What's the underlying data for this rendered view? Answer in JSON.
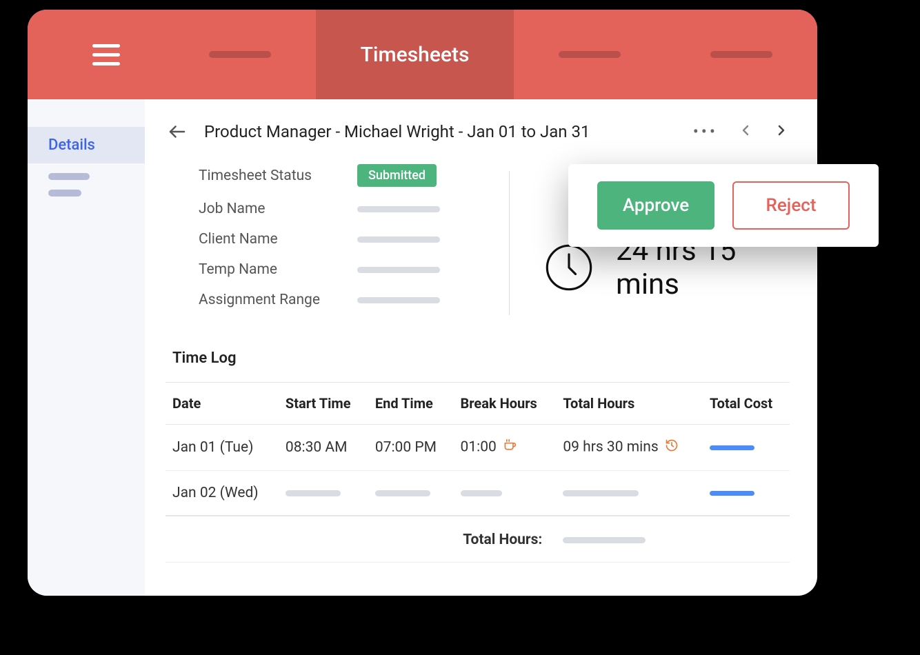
{
  "header": {
    "active_tab_label": "Timesheets"
  },
  "sidebar": {
    "active_label": "Details"
  },
  "page": {
    "title": "Product Manager - Michael Wright  - Jan 01 to Jan 31"
  },
  "status": {
    "labels": {
      "timesheet_status": "Timesheet Status",
      "job_name": "Job Name",
      "client_name": "Client Name",
      "temp_name": "Temp Name",
      "assignment_range": "Assignment Range"
    },
    "status_value": "Submitted",
    "total_hours": "24 hrs 15 mins"
  },
  "actions": {
    "approve": "Approve",
    "reject": "Reject"
  },
  "timelog": {
    "title": "Time Log",
    "columns": {
      "date": "Date",
      "start": "Start Time",
      "end": "End Time",
      "break": "Break Hours",
      "total": "Total Hours",
      "cost": "Total Cost"
    },
    "rows": [
      {
        "date": "Jan 01 (Tue)",
        "start": "08:30 AM",
        "end": "07:00 PM",
        "break": "01:00",
        "total": "09 hrs 30 mins"
      },
      {
        "date": "Jan 02 (Wed)"
      }
    ],
    "footer_label": "Total Hours:"
  }
}
